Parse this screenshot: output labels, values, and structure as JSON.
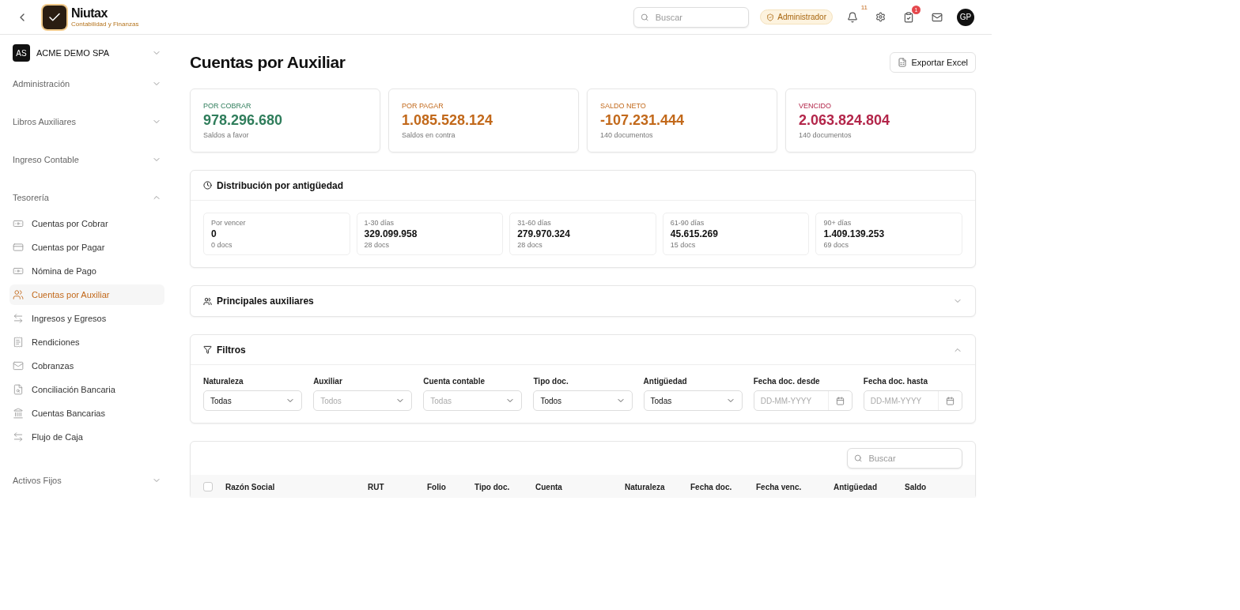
{
  "header": {
    "brand": {
      "name": "Niutax",
      "tagline": "Contabilidad y Finanzas"
    },
    "search": {
      "placeholder": "Buscar"
    },
    "role": "Administrador",
    "notifications": "11",
    "tasks": "1",
    "avatar": "GP"
  },
  "sidebar": {
    "company": {
      "initials": "AS",
      "name": "ACME DEMO SPA"
    },
    "sections": [
      {
        "label": "Administración",
        "expanded": false
      },
      {
        "label": "Libros Auxiliares",
        "expanded": false
      },
      {
        "label": "Ingreso Contable",
        "expanded": false
      },
      {
        "label": "Tesorería",
        "expanded": true,
        "items": [
          {
            "label": "Cuentas por Cobrar",
            "selected": false
          },
          {
            "label": "Cuentas por Pagar",
            "selected": false
          },
          {
            "label": "Nómina de Pago",
            "selected": false
          },
          {
            "label": "Cuentas por Auxiliar",
            "selected": true
          },
          {
            "label": "Ingresos y Egresos",
            "selected": false
          },
          {
            "label": "Rendiciones",
            "selected": false
          },
          {
            "label": "Cobranzas",
            "selected": false
          },
          {
            "label": "Conciliación Bancaria",
            "selected": false
          },
          {
            "label": "Cuentas Bancarias",
            "selected": false
          },
          {
            "label": "Flujo de Caja",
            "selected": false
          }
        ]
      },
      {
        "label": "Activos Fijos",
        "expanded": false
      }
    ]
  },
  "page": {
    "title": "Cuentas por Auxiliar",
    "export_button": "Exportar Excel"
  },
  "summary_cards": [
    {
      "label": "POR COBRAR",
      "value": "978.296.680",
      "note": "Saldos a favor",
      "color": "#2f7d5b"
    },
    {
      "label": "POR PAGAR",
      "value": "1.085.528.124",
      "note": "Saldos en contra",
      "color": "#c2691b"
    },
    {
      "label": "SALDO NETO",
      "value": "-107.231.444",
      "note": "140 documentos",
      "color": "#c2691b"
    },
    {
      "label": "VENCIDO",
      "value": "2.063.824.804",
      "note": "140 documentos",
      "color": "#b3264a"
    }
  ],
  "aging": {
    "title": "Distribución por antigüedad",
    "buckets": [
      {
        "label": "Por vencer",
        "value": "0",
        "docs": "0 docs"
      },
      {
        "label": "1-30 días",
        "value": "329.099.958",
        "docs": "28 docs"
      },
      {
        "label": "31-60 días",
        "value": "279.970.324",
        "docs": "28 docs"
      },
      {
        "label": "61-90 días",
        "value": "45.615.269",
        "docs": "15 docs"
      },
      {
        "label": "90+ días",
        "value": "1.409.139.253",
        "docs": "69 docs"
      }
    ]
  },
  "top_auxiliaries": {
    "title": "Principales auxiliares",
    "expanded": false
  },
  "filters": {
    "title": "Filtros",
    "expanded": true,
    "fields": [
      {
        "kind": "select",
        "label": "Naturaleza",
        "value": "Todas"
      },
      {
        "kind": "select",
        "label": "Auxiliar",
        "placeholder": "Todos"
      },
      {
        "kind": "select",
        "label": "Cuenta contable",
        "placeholder": "Todas"
      },
      {
        "kind": "select",
        "label": "Tipo doc.",
        "value": "Todos"
      },
      {
        "kind": "select",
        "label": "Antigüedad",
        "value": "Todas"
      },
      {
        "kind": "date",
        "label": "Fecha doc. desde",
        "placeholder": "DD-MM-YYYY"
      },
      {
        "kind": "date",
        "label": "Fecha doc. hasta",
        "placeholder": "DD-MM-YYYY"
      }
    ]
  },
  "table": {
    "search": {
      "placeholder": "Buscar"
    },
    "select_all": {
      "checked": false
    },
    "columns": [
      "Razón Social",
      "RUT",
      "Folio",
      "Tipo doc.",
      "Cuenta",
      "Naturaleza",
      "Fecha doc.",
      "Fecha venc.",
      "Antigüedad",
      "Saldo"
    ]
  }
}
